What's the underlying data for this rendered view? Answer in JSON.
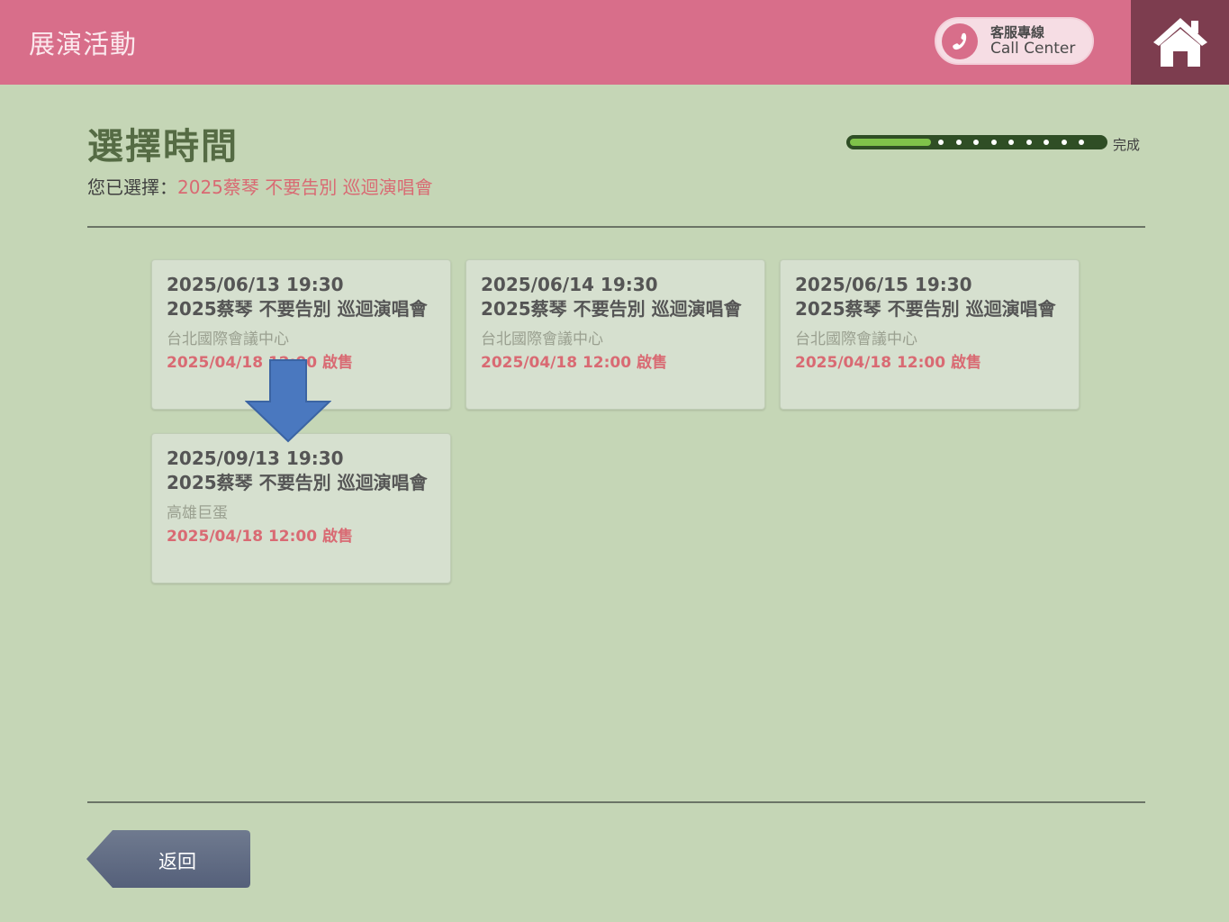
{
  "header": {
    "title": "展演活動",
    "call_center_zh": "客服專線",
    "call_center_en": "Call Center"
  },
  "page": {
    "title": "選擇時間",
    "selected_label": "您已選擇：",
    "selected_value": "2025蔡琴 不要告別 巡迴演唱會",
    "progress_label": "完成",
    "progress_fraction": 0.32
  },
  "sessions": [
    {
      "datetime": "2025/06/13 19:30",
      "name": "2025蔡琴 不要告別 巡迴演唱會",
      "venue": "台北國際會議中心",
      "sale": "2025/04/18 12:00 啟售"
    },
    {
      "datetime": "2025/06/14 19:30",
      "name": "2025蔡琴 不要告別 巡迴演唱會",
      "venue": "台北國際會議中心",
      "sale": "2025/04/18 12:00 啟售"
    },
    {
      "datetime": "2025/06/15 19:30",
      "name": "2025蔡琴 不要告別 巡迴演唱會",
      "venue": "台北國際會議中心",
      "sale": "2025/04/18 12:00 啟售"
    },
    {
      "datetime": "2025/09/13 19:30",
      "name": "2025蔡琴 不要告別 巡迴演唱會",
      "venue": "高雄巨蛋",
      "sale": "2025/04/18 12:00 啟售"
    }
  ],
  "footer": {
    "back_label": "返回"
  },
  "colors": {
    "header": "#d86e8a",
    "home": "#7d3d4f",
    "background": "#c5d6b6",
    "accent_red": "#d96a73",
    "arrow": "#4a78bf"
  },
  "icons": {
    "call": "phone-icon",
    "home": "home-icon",
    "pointer": "down-arrow-icon"
  }
}
